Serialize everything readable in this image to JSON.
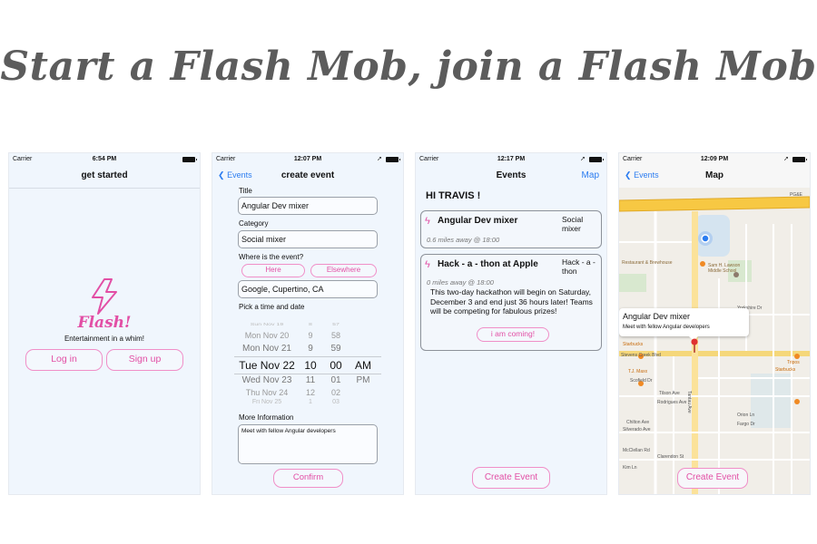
{
  "headline": "Start a Flash Mob,  join a Flash Mob",
  "screens": {
    "s1": {
      "carrier": "Carrier",
      "time": "6:54 PM",
      "title": "get started",
      "logo_text": "Flash!",
      "tagline": "Entertainment in a whim!",
      "login": "Log in",
      "signup": "Sign up"
    },
    "s2": {
      "carrier": "Carrier",
      "time": "12:07 PM",
      "back": "Events",
      "title": "create event",
      "title_label": "Title",
      "title_value": "Angular Dev mixer",
      "category_label": "Category",
      "category_value": "Social mixer",
      "where_label": "Where is the event?",
      "here": "Here",
      "elsewhere": "Elsewhere",
      "location_value": "Google, Cupertino, CA",
      "pick_label": "Pick a time and date",
      "picker": [
        {
          "d": "Sun Nov 19",
          "h": "8",
          "m": "57",
          "p": ""
        },
        {
          "d": "Mon Nov 20",
          "h": "9",
          "m": "58",
          "p": ""
        },
        {
          "d": "Mon Nov 21",
          "h": "9",
          "m": "59",
          "p": ""
        },
        {
          "d": "Tue Nov 22",
          "h": "10",
          "m": "00",
          "p": "AM"
        },
        {
          "d": "Wed Nov 23",
          "h": "11",
          "m": "01",
          "p": "PM"
        },
        {
          "d": "Thu Nov 24",
          "h": "12",
          "m": "02",
          "p": ""
        },
        {
          "d": "Fri Nov 25",
          "h": "1",
          "m": "03",
          "p": ""
        }
      ],
      "more_label": "More Information",
      "more_value": "Meet with fellow Angular developers",
      "confirm": "Confirm"
    },
    "s3": {
      "carrier": "Carrier",
      "time": "12:17 PM",
      "title": "Events",
      "map": "Map",
      "greeting": "HI TRAVIS !",
      "card1_title": "Angular Dev mixer",
      "card1_cat": "Social mixer",
      "card1_dist": "0.6 miles away @ 18:00",
      "card2_title": "Hack - a - thon at Apple",
      "card2_cat": "Hack - a - thon",
      "card2_dist": "0 miles away @ 18:00",
      "card2_desc": "This two-day hackathon will begin on Saturday, December 3 and end just 36 hours later! Teams will be competing for fabulous prizes!",
      "card2_btn": "i am coming!",
      "create": "Create Event"
    },
    "s4": {
      "carrier": "Carrier",
      "time": "12:09 PM",
      "back": "Events",
      "title": "Map",
      "callout_title": "Angular Dev mixer",
      "callout_sub": "Meet with fellow Angular developers",
      "create": "Create Event",
      "map_labels": [
        "Restaurant & Brewhouse",
        "Sam H. Lawson Middle School",
        "Starbucks",
        "Stevens Creek Blvd",
        "T.J. Maxx",
        "Scofield Dr",
        "Rodrigues Ave",
        "Starbucks",
        "Chilton Ave",
        "McClellan Rd",
        "Silverado Ave",
        "Kim Ln",
        "Tilson Ave",
        "Tantau Ave",
        "Clarendon St",
        "Yorkshire Dr",
        "Orion Ln",
        "Fargo Dr",
        "PG&E",
        "Tripos"
      ]
    }
  },
  "colors": {
    "accent_pink": "#e24fa5",
    "ios_blue": "#2b7cf0",
    "screen_bg": "#f0f6fd"
  }
}
